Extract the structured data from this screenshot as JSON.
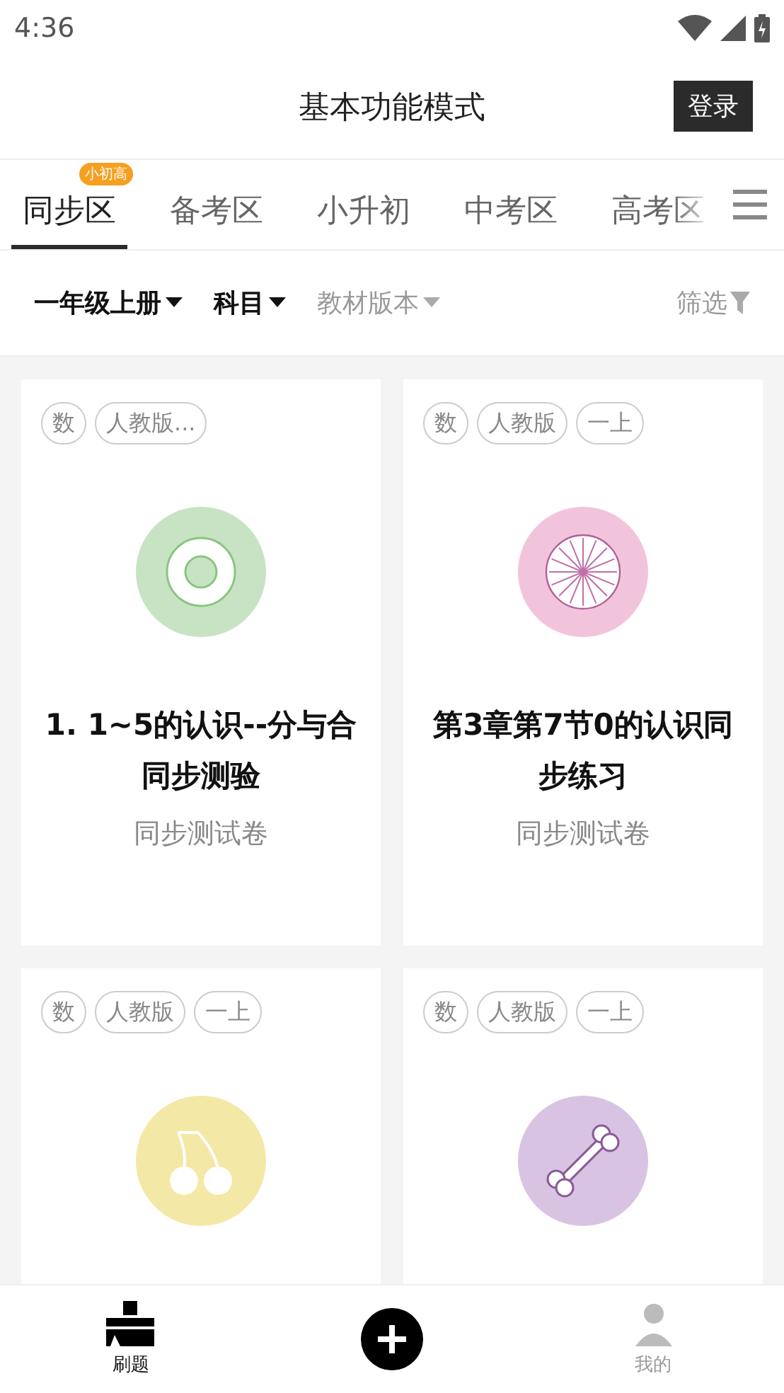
{
  "status_bar": {
    "time": "4:36"
  },
  "header": {
    "title": "基本功能模式",
    "login_button": "登录"
  },
  "tabs": [
    {
      "label": "同步区",
      "selected": true,
      "badge": "小初高"
    },
    {
      "label": "备考区",
      "selected": false
    },
    {
      "label": "小升初",
      "selected": false
    },
    {
      "label": "中考区",
      "selected": false
    },
    {
      "label": "高考区",
      "selected": false
    }
  ],
  "filters": [
    {
      "label": "一年级上册",
      "active": true
    },
    {
      "label": "科目",
      "active": true
    },
    {
      "label": "教材版本",
      "active": false
    }
  ],
  "filter_button": "筛选",
  "cards": [
    {
      "tags": [
        "数",
        "人教版..."
      ],
      "kind": "target",
      "color": "#c7e3c4",
      "title": "1. 1~5的认识--分与合同步测验",
      "subtitle": "同步测试卷"
    },
    {
      "tags": [
        "数",
        "人教版",
        "一上"
      ],
      "kind": "wheel",
      "color": "#f2c4dc",
      "title": "第3章第7节0的认识同步练习",
      "subtitle": "同步测试卷"
    },
    {
      "tags": [
        "数",
        "人教版",
        "一上"
      ],
      "kind": "cherry",
      "color": "#f4e8a6"
    },
    {
      "tags": [
        "数",
        "人教版",
        "一上"
      ],
      "kind": "bone",
      "color": "#d9c3e2"
    }
  ],
  "bottom_nav": [
    {
      "label": "刷题",
      "kind": "practice",
      "selected": true
    },
    {
      "kind": "add"
    },
    {
      "label": "我的",
      "kind": "profile",
      "selected": false
    }
  ]
}
